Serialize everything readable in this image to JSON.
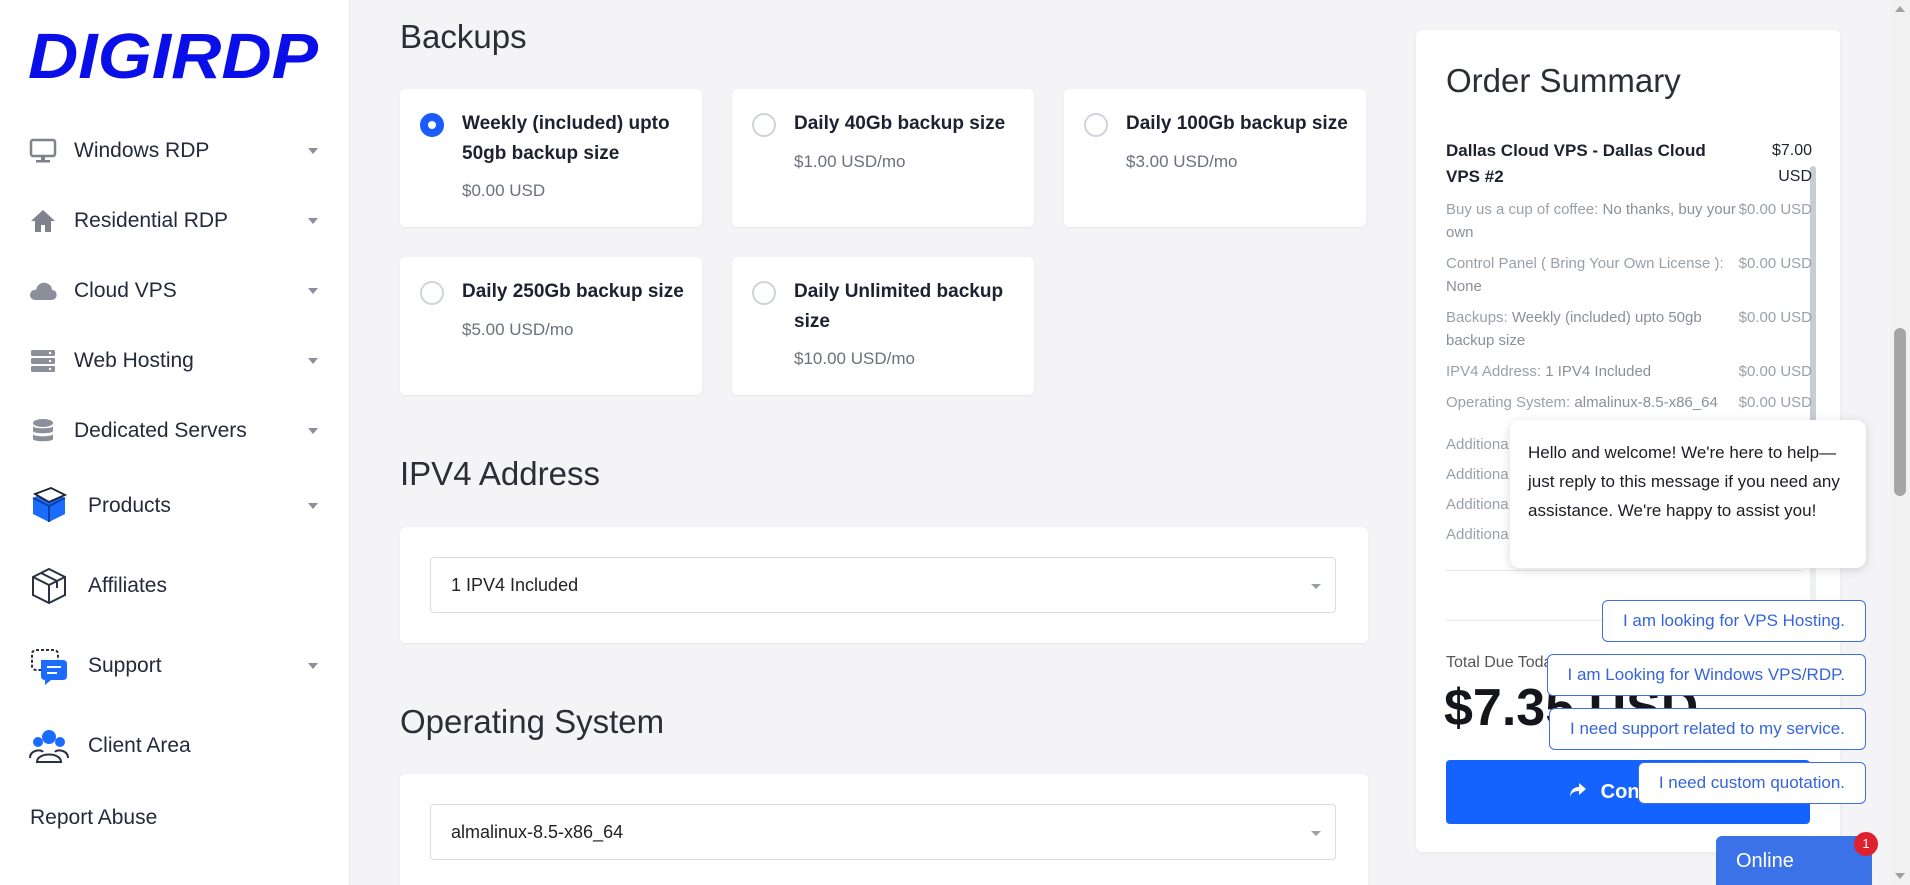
{
  "brand": {
    "logo_text": "DIGIRDP",
    "accent": "#1463ff"
  },
  "sidebar": {
    "items": [
      {
        "label": "Windows RDP",
        "icon": "monitor-icon"
      },
      {
        "label": "Residential RDP",
        "icon": "home-icon"
      },
      {
        "label": "Cloud VPS",
        "icon": "cloud-icon"
      },
      {
        "label": "Web Hosting",
        "icon": "server-icon"
      },
      {
        "label": "Dedicated Servers",
        "icon": "database-icon"
      },
      {
        "label": "Products",
        "icon": "box-icon"
      },
      {
        "label": "Affiliates",
        "icon": "package-icon"
      },
      {
        "label": "Support",
        "icon": "chat-support-icon"
      },
      {
        "label": "Client Area",
        "icon": "users-icon"
      }
    ],
    "report_abuse": "Report Abuse"
  },
  "backups": {
    "title": "Backups",
    "options": [
      {
        "name": "Weekly (included) upto 50gb backup size",
        "price": "$0.00 USD",
        "selected": true
      },
      {
        "name": "Daily 40Gb backup size",
        "price": "$1.00 USD/mo",
        "selected": false
      },
      {
        "name": "Daily 100Gb backup size",
        "price": "$3.00 USD/mo",
        "selected": false
      },
      {
        "name": "Daily 250Gb backup size",
        "price": "$5.00 USD/mo",
        "selected": false
      },
      {
        "name": "Daily Unlimited backup size",
        "price": "$10.00 USD/mo",
        "selected": false
      }
    ]
  },
  "ipv4": {
    "title": "IPV4 Address",
    "value": "1 IPV4 Included"
  },
  "os": {
    "title": "Operating System",
    "value": "almalinux-8.5-x86_64"
  },
  "summary": {
    "title": "Order Summary",
    "product": {
      "name": "Dallas Cloud VPS - Dallas Cloud VPS #2",
      "price": "$7.00 USD"
    },
    "lines": [
      {
        "label": "Buy us a cup of coffee:",
        "value": "No thanks, buy your own",
        "price": "$0.00 USD"
      },
      {
        "label": "Control Panel ( Bring Your Own License ):",
        "value": "None",
        "price": "$0.00 USD"
      },
      {
        "label": "Backups:",
        "value": "Weekly (included) upto 50gb backup size",
        "price": "$0.00 USD"
      },
      {
        "label": "IPV4 Address:",
        "value": "1 IPV4 Included",
        "price": "$0.00 USD"
      },
      {
        "label": "Operating System:",
        "value": "almalinux-8.5-x86_64",
        "price": "$0.00 USD"
      }
    ],
    "hidden_prefix": "Additiona",
    "total_label": "Total Due Today",
    "total": "$7.35 USD",
    "continue_label": "Continue"
  },
  "chat": {
    "message": "Hello and welcome! We're here to help—just reply to this message if you need any assistance. We're happy to assist you!",
    "quick_replies": [
      "I am looking for VPS Hosting.",
      "I am Looking for Windows VPS/RDP.",
      "I need support related to my service.",
      "I need custom quotation."
    ],
    "status": "Online",
    "badge": "1"
  }
}
